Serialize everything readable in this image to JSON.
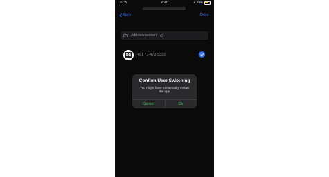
{
  "status_bar": {
    "time": "6:41",
    "battery": "69%"
  },
  "nav": {
    "back_label": "Back",
    "done_label": "Done"
  },
  "add_account": {
    "label": "Add new account"
  },
  "account": {
    "avatar_text": "BB",
    "phone_number": "+91 77-473 5333",
    "selected": true
  },
  "dialog": {
    "title": "Confirm User Switching",
    "message_line1": "You might have to manually restart",
    "message_line2": "the app",
    "cancel_label": "Cancel",
    "ok_label": "Ok"
  },
  "colors": {
    "accent_blue": "#2f6df6",
    "action_green": "#38c25b",
    "background": "#0b0b0c",
    "dialog_bg": "#2a2a2c"
  },
  "icons": {
    "back": "chevron-left-icon",
    "add": "add-user-icon",
    "info": "info-icon",
    "check": "checkmark-circle-icon"
  }
}
